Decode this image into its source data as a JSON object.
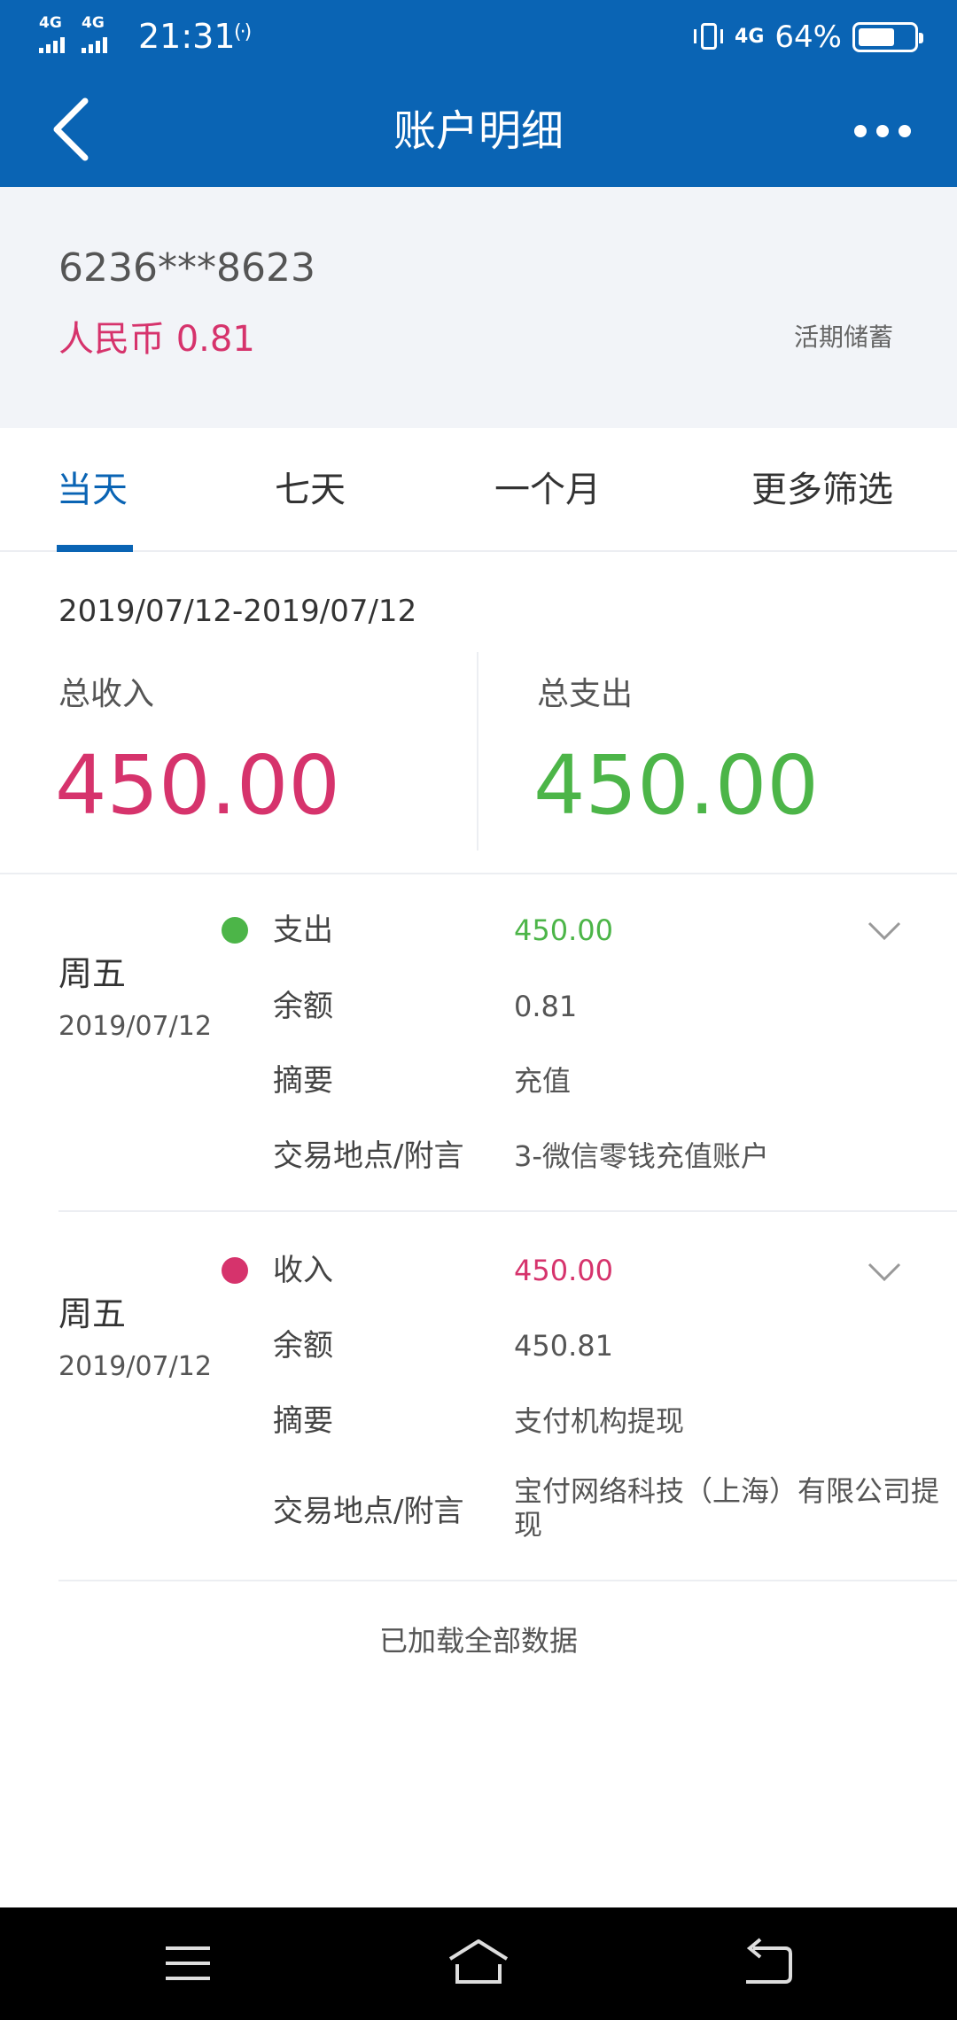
{
  "status_bar": {
    "signal_1": "4G",
    "signal_2": "4G",
    "time": "21:31",
    "nfc": "(·)",
    "signal_3": "4G",
    "battery_text": "64%",
    "battery_level": 0.64,
    "icons": [
      "signal-icon",
      "signal-icon",
      "nfc-icon",
      "vibrate-icon",
      "signal-icon",
      "battery-icon"
    ]
  },
  "nav": {
    "back_icon": "chevron-left-icon",
    "title": "账户明细",
    "more_icon": "more-dots-icon"
  },
  "account": {
    "number": "6236***8623",
    "balance": "人民币 0.81",
    "type": "活期储蓄"
  },
  "tabs": [
    {
      "label": "当天",
      "active": true
    },
    {
      "label": "七天",
      "active": false
    },
    {
      "label": "一个月",
      "active": false
    },
    {
      "label": "更多筛选",
      "active": false
    }
  ],
  "summary": {
    "date_range": "2019/07/12-2019/07/12",
    "income_label": "总收入",
    "income_value": "450.00",
    "expense_label": "总支出",
    "expense_value": "450.00"
  },
  "transactions": [
    {
      "day": "周五",
      "date": "2019/07/12",
      "dot_color": "#4cb548",
      "type_label": "支出",
      "amount": "450.00",
      "amount_color": "#4cb548",
      "balance_label": "余额",
      "balance": "0.81",
      "summary_label": "摘要",
      "summary": "充值",
      "location_label": "交易地点/附言",
      "location": "3-微信零钱充值账户"
    },
    {
      "day": "周五",
      "date": "2019/07/12",
      "dot_color": "#d6336c",
      "type_label": "收入",
      "amount": "450.00",
      "amount_color": "#d6336c",
      "balance_label": "余额",
      "balance": "450.81",
      "summary_label": "摘要",
      "summary": "支付机构提现",
      "location_label": "交易地点/附言",
      "location": "宝付网络科技（上海）有限公司提现"
    }
  ],
  "footer": {
    "load_all": "已加载全部数据"
  },
  "system_nav": {
    "icons": [
      "menu-icon",
      "home-icon",
      "back-icon"
    ]
  },
  "colors": {
    "primary": "#0a64b4",
    "income": "#d6336c",
    "expense": "#4cb548"
  }
}
